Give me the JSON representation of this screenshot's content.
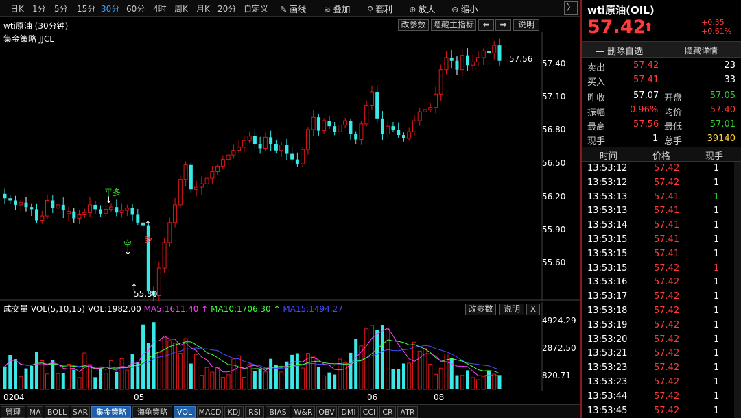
{
  "toolbar": {
    "timeframes": [
      "日K",
      "1分",
      "5分",
      "15分",
      "30分",
      "60分",
      "4时",
      "周K",
      "月K",
      "20分",
      "自定义"
    ],
    "active_timeframe": "30分",
    "tools": [
      {
        "icon": "pencil-icon",
        "label": "画线"
      },
      {
        "icon": "layers-icon",
        "label": "叠加"
      },
      {
        "icon": "arbitrage-icon",
        "label": "套利"
      },
      {
        "icon": "zoom-in-icon",
        "label": "放大"
      },
      {
        "icon": "zoom-out-icon",
        "label": "缩小"
      }
    ],
    "next_glyph": "〉"
  },
  "chart_header": {
    "title": "wti原油 (30分钟)",
    "strategy": "集金策略 JJCL",
    "btn_params": "改参数",
    "btn_hide": "隐藏主指标",
    "btn_left": "⬅",
    "btn_right": "➡",
    "btn_help": "说明"
  },
  "price_axis": [
    "57.40",
    "57.10",
    "56.80",
    "56.50",
    "56.20",
    "55.90",
    "55.60"
  ],
  "annotations": {
    "high_price": "57.56",
    "low_price": "55.30",
    "ping_duo": "平多",
    "kong": "空",
    "duo": "多"
  },
  "volume": {
    "label": "成交量 VOL(5,10,15)",
    "vol": "VOL:1982.00",
    "ma5": "MA5:1611.40",
    "ma10": "MA10:1706.30",
    "ma15": "MA15:1494.27",
    "btn_params": "改参数",
    "btn_help": "说明",
    "btn_close": "X",
    "axis": [
      "4924.29",
      "2872.50",
      "820.71"
    ]
  },
  "x_axis": [
    "0204",
    "05",
    "06",
    "08"
  ],
  "bottom_tabs": [
    "管理",
    "MA",
    "BOLL",
    "SAR",
    "集金策略",
    "海龟策略",
    "VOL",
    "MACD",
    "KDJ",
    "RSI",
    "BIAS",
    "W&R",
    "OBV",
    "DMI",
    "CCI",
    "CR",
    "ATR"
  ],
  "active_tabs": [
    "集金策略",
    "VOL"
  ],
  "quote": {
    "name": "wti原油(OIL)",
    "price": "57.42",
    "arrow": "⬆",
    "change": "+0.35",
    "change_pct": "+0.61%",
    "btn_remove": "— 删除自选",
    "btn_hide": "隐藏详情",
    "sell_label": "卖出",
    "sell_price": "57.42",
    "sell_qty": "23",
    "buy_label": "买入",
    "buy_price": "57.41",
    "buy_qty": "33",
    "prev_close_label": "昨收",
    "prev_close": "57.07",
    "open_label": "开盘",
    "open": "57.05",
    "amp_label": "振幅",
    "amp": "0.96%",
    "avg_label": "均价",
    "avg": "57.40",
    "high_label": "最高",
    "high": "57.56",
    "low_label": "最低",
    "low": "57.01",
    "cur_hand_label": "现手",
    "cur_hand": "1",
    "total_hand_label": "总手",
    "total_hand": "39140"
  },
  "ticks": {
    "headers": [
      "时间",
      "价格",
      "现手"
    ],
    "rows": [
      {
        "time": "13:53:12",
        "price": "57.42",
        "qty": "1",
        "pc": "red",
        "qc": "wht"
      },
      {
        "time": "13:53:12",
        "price": "57.42",
        "qty": "1",
        "pc": "red",
        "qc": "wht"
      },
      {
        "time": "13:53:13",
        "price": "57.41",
        "qty": "1",
        "pc": "red",
        "qc": "grn"
      },
      {
        "time": "13:53:13",
        "price": "57.41",
        "qty": "1",
        "pc": "red",
        "qc": "wht"
      },
      {
        "time": "13:53:14",
        "price": "57.41",
        "qty": "1",
        "pc": "red",
        "qc": "wht"
      },
      {
        "time": "13:53:15",
        "price": "57.41",
        "qty": "1",
        "pc": "red",
        "qc": "wht"
      },
      {
        "time": "13:53:15",
        "price": "57.41",
        "qty": "1",
        "pc": "red",
        "qc": "wht"
      },
      {
        "time": "13:53:15",
        "price": "57.42",
        "qty": "1",
        "pc": "red",
        "qc": "red"
      },
      {
        "time": "13:53:16",
        "price": "57.42",
        "qty": "1",
        "pc": "red",
        "qc": "wht"
      },
      {
        "time": "13:53:17",
        "price": "57.42",
        "qty": "1",
        "pc": "red",
        "qc": "wht"
      },
      {
        "time": "13:53:18",
        "price": "57.42",
        "qty": "1",
        "pc": "red",
        "qc": "wht"
      },
      {
        "time": "13:53:19",
        "price": "57.42",
        "qty": "1",
        "pc": "red",
        "qc": "wht"
      },
      {
        "time": "13:53:20",
        "price": "57.42",
        "qty": "1",
        "pc": "red",
        "qc": "wht"
      },
      {
        "time": "13:53:21",
        "price": "57.42",
        "qty": "1",
        "pc": "red",
        "qc": "wht"
      },
      {
        "time": "13:53:23",
        "price": "57.42",
        "qty": "1",
        "pc": "red",
        "qc": "wht"
      },
      {
        "time": "13:53:23",
        "price": "57.42",
        "qty": "1",
        "pc": "red",
        "qc": "wht"
      },
      {
        "time": "13:53:44",
        "price": "57.42",
        "qty": "1",
        "pc": "red",
        "qc": "wht"
      },
      {
        "time": "13:53:45",
        "price": "57.42",
        "qty": "1",
        "pc": "red",
        "qc": "wht"
      }
    ]
  },
  "colors": {
    "up": "#e01818",
    "down": "#3ae8e8",
    "ma5": "#ff40ff",
    "ma10": "#40ff40",
    "ma15": "#4a4aff",
    "accent": "#3aa0ff"
  },
  "chart_data": {
    "type": "candlestick",
    "series": [
      {
        "name": "price",
        "values": [
          56.18,
          56.16,
          56.12,
          56.14,
          56.1,
          56.08,
          55.98,
          56.02,
          56.16,
          56.09,
          56.12,
          56.07,
          56.06,
          56.0,
          56.03,
          56.05,
          56.12,
          56.08,
          56.04,
          56.08,
          56.1,
          56.05,
          56.07,
          56.09,
          56.03,
          55.96,
          55.93,
          55.34,
          55.3,
          55.55,
          55.78,
          55.96,
          56.12,
          56.35,
          56.48,
          56.26,
          56.28,
          56.31,
          56.36,
          56.42,
          56.47,
          56.53,
          56.57,
          56.61,
          56.64,
          56.7,
          56.74,
          56.67,
          56.63,
          56.73,
          56.67,
          56.61,
          56.66,
          56.58,
          56.53,
          56.49,
          56.62,
          56.8,
          56.91,
          56.79,
          56.88,
          56.83,
          56.78,
          56.84,
          56.88,
          56.76,
          56.71,
          56.85,
          57.02,
          57.14,
          56.9,
          56.76,
          56.83,
          56.8,
          56.75,
          56.72,
          56.78,
          56.88,
          56.96,
          56.98,
          57.0,
          57.12,
          57.34,
          57.45,
          57.42,
          57.34,
          57.47,
          57.38,
          57.41,
          57.45,
          57.51,
          57.49,
          57.56,
          57.42
        ]
      }
    ],
    "volume_axis": [
      "4924.29",
      "2872.50",
      "820.71"
    ]
  }
}
